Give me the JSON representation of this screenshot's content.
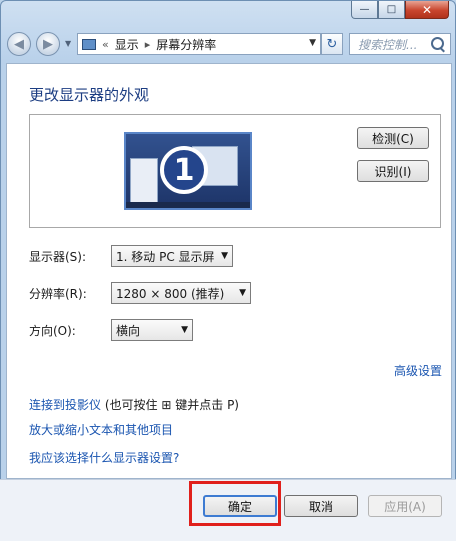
{
  "window": {
    "minimize_glyph": "—",
    "maximize_glyph": "□",
    "close_glyph": "✕"
  },
  "toolbar": {
    "back_glyph": "◀",
    "forward_glyph": "▶",
    "breadcrumb_sep": "«",
    "breadcrumb": [
      "显示",
      "屏幕分辨率"
    ],
    "search_placeholder": "搜索控制...",
    "refresh_glyph": "↻"
  },
  "panel": {
    "title": "更改显示器的外观",
    "monitor_number": "1",
    "detect_button": "检测(C)",
    "identify_button": "识别(I)"
  },
  "settings": {
    "display_label": "显示器(S):",
    "display_value": "1. 移动 PC 显示屏",
    "resolution_label": "分辨率(R):",
    "resolution_value": "1280 × 800 (推荐)",
    "orientation_label": "方向(O):",
    "orientation_value": "横向"
  },
  "links": {
    "advanced": "高级设置",
    "projector": "连接到投影仪",
    "projector_note": "(也可按住",
    "projector_note_end": "键并点击 P)",
    "text_size": "放大或缩小文本和其他项目",
    "which_settings": "我应该选择什么显示器设置?"
  },
  "footer": {
    "ok": "确定",
    "cancel": "取消",
    "apply": "应用(A)"
  },
  "colors": {
    "link": "#1a55b0",
    "title": "#1c3d82",
    "highlight": "#e0201c"
  }
}
